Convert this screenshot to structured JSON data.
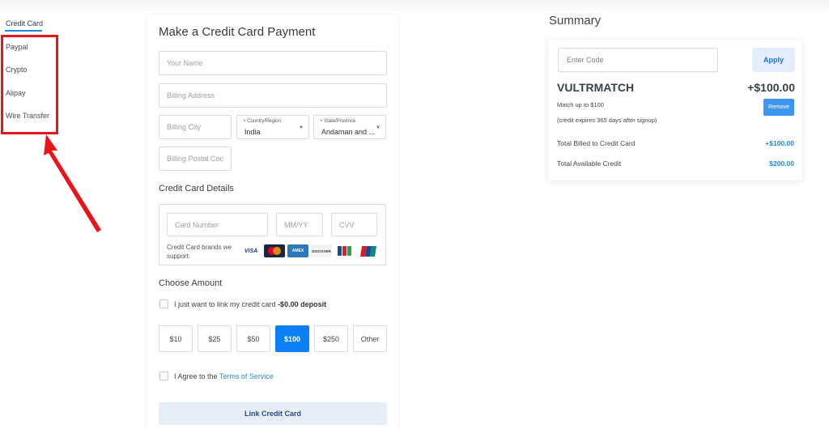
{
  "sidebar": {
    "active": "Credit Card",
    "items": [
      "Paypal",
      "Crypto",
      "Alipay",
      "Wire Transfer"
    ]
  },
  "payment": {
    "title": "Make a Credit Card Payment",
    "name_placeholder": "Your Name",
    "address_placeholder": "Billing Address",
    "city_placeholder": "Billing City",
    "country_label": "Country/Region",
    "country_value": "India",
    "state_label": "State/Province",
    "state_value": "Andaman and ...",
    "postal_placeholder": "Billing Postal Coc",
    "cc_heading": "Credit Card Details",
    "card_number_placeholder": "Card Number",
    "expiry_placeholder": "MM/YY",
    "cvv_placeholder": "CVV",
    "brands_text": "Credit Card brands we support:",
    "brands": [
      "VISA",
      "MC",
      "AMEX",
      "DISCOVER",
      "JCB",
      "UnionPay"
    ],
    "amount_heading": "Choose Amount",
    "link_only_text": "I just want to link my credit card",
    "link_only_bold": "-$0.00 deposit",
    "amounts": [
      "$10",
      "$25",
      "$50",
      "$100",
      "$250",
      "Other"
    ],
    "selected_amount": "$100",
    "agree_text": "I Agree to the",
    "tos_link": "Terms of Service",
    "submit_label": "Link Credit Card"
  },
  "summary": {
    "title": "Summary",
    "code_placeholder": "Enter Code",
    "apply_label": "Apply",
    "promo_code": "VULTRMATCH",
    "promo_amount": "+$100.00",
    "promo_desc1": "Match up to $100",
    "promo_desc2": "(credit expires 365 days after signup)",
    "remove_label": "Remove",
    "billed_label": "Total Billed to Credit Card",
    "billed_value": "+$100.00",
    "available_label": "Total Available Credit",
    "available_value": "$200.00"
  },
  "colors": {
    "accent": "#1e88e5",
    "selected_amount_bg": "#0b7ff5",
    "annotation_red": "#e8141a"
  }
}
